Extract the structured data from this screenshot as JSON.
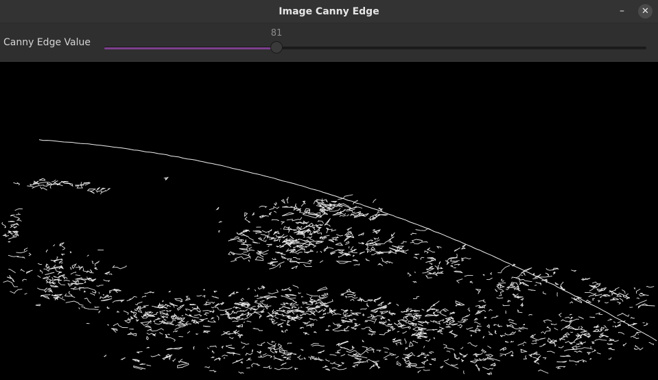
{
  "window": {
    "title": "Image Canny Edge",
    "minimize_glyph": "–",
    "close_glyph": "✕"
  },
  "trackbar": {
    "label": "Canny Edge Value",
    "value": "81",
    "value_number": 81,
    "max": 255,
    "accent_color": "#7e3f8f"
  },
  "image": {
    "description": "canny edge map of Earth horizon from orbit"
  }
}
